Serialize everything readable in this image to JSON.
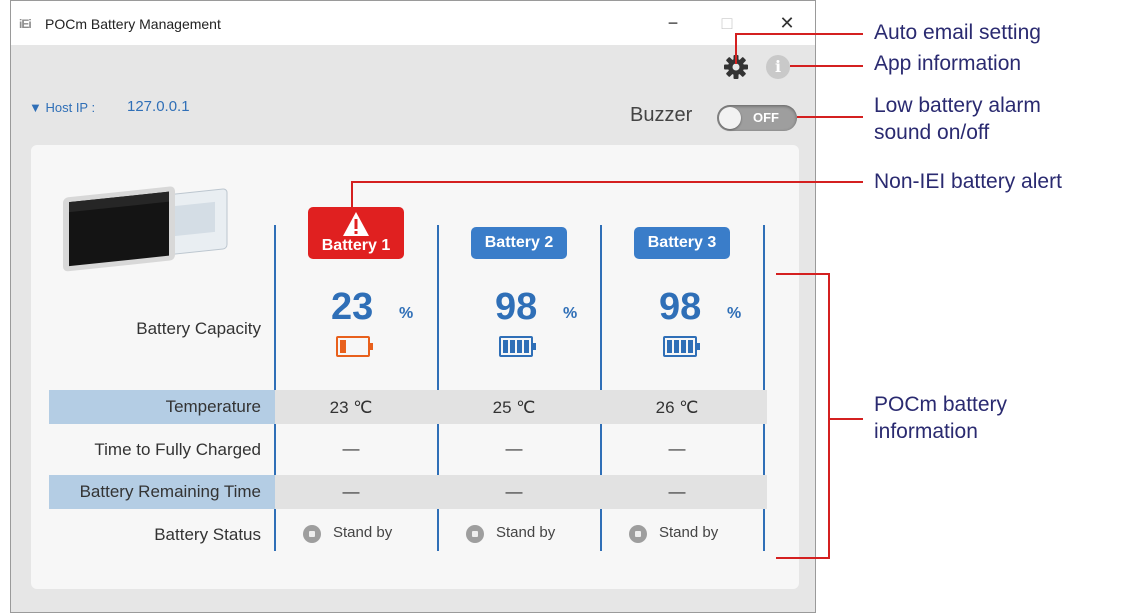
{
  "window": {
    "logo": "iEi",
    "title": "POCm Battery Management",
    "minimize": "−",
    "maximize": "□",
    "close": "✕"
  },
  "toolbar": {
    "info_glyph": "i",
    "gear_icon": "gear-icon",
    "info_icon": "info-icon"
  },
  "host": {
    "label": "▼ Host IP :",
    "value": "127.0.0.1"
  },
  "buzzer": {
    "label": "Buzzer",
    "state": "OFF"
  },
  "batteries": [
    {
      "name": "Battery 1",
      "alert": true,
      "capacity": "23",
      "unit": "%",
      "level": 0.23,
      "temperature": "23 ℃",
      "time_to_full": "—",
      "remaining": "—",
      "status": "Stand by"
    },
    {
      "name": "Battery 2",
      "alert": false,
      "capacity": "98",
      "unit": "%",
      "level": 0.98,
      "temperature": "25 ℃",
      "time_to_full": "—",
      "remaining": "—",
      "status": "Stand by"
    },
    {
      "name": "Battery 3",
      "alert": false,
      "capacity": "98",
      "unit": "%",
      "level": 0.98,
      "temperature": "26 ℃",
      "time_to_full": "—",
      "remaining": "—",
      "status": "Stand by"
    }
  ],
  "rows": {
    "capacity": "Battery Capacity",
    "temperature": "Temperature",
    "time_to_full": "Time to Fully Charged",
    "remaining": "Battery Remaining Time",
    "status": "Battery Status"
  },
  "colors": {
    "accent": "#2f6fb7",
    "alert": "#e02020",
    "low_battery": "#e8601c",
    "annotation": "#d42020"
  },
  "annotations": {
    "auto_email": "Auto email setting",
    "app_info": "App information",
    "buzzer_1": "Low battery alarm",
    "buzzer_2": "sound on/off",
    "non_iei": "Non-IEI battery alert",
    "battery_info_1": "POCm battery",
    "battery_info_2": "information"
  }
}
